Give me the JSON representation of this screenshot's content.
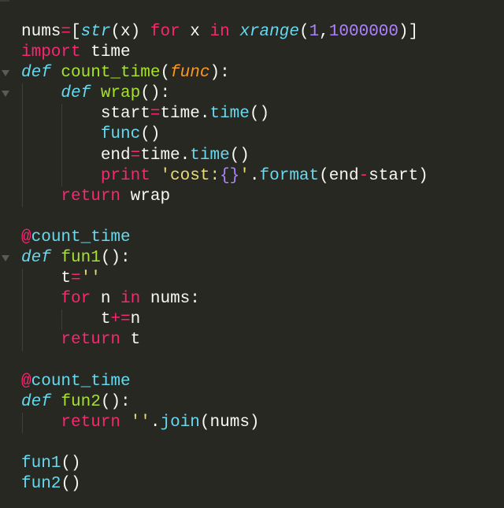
{
  "editor": {
    "theme_colors": {
      "background": "#272822",
      "keyword": "#f92672",
      "storage": "#66d9ef",
      "function_name": "#a6e22e",
      "parameter": "#fd971f",
      "number": "#ae81ff",
      "string": "#e6db74",
      "text": "#f8f8f2"
    },
    "lines": [
      {
        "fold": false,
        "indent": 0,
        "tokens": [
          {
            "t": "nums",
            "c": "plain"
          },
          {
            "t": "=",
            "c": "op"
          },
          {
            "t": "[",
            "c": "plain"
          },
          {
            "t": "str",
            "c": "bi"
          },
          {
            "t": "(x) ",
            "c": "plain"
          },
          {
            "t": "for",
            "c": "kw"
          },
          {
            "t": " x ",
            "c": "plain"
          },
          {
            "t": "in",
            "c": "kw"
          },
          {
            "t": " ",
            "c": "plain"
          },
          {
            "t": "xrange",
            "c": "bi"
          },
          {
            "t": "(",
            "c": "plain"
          },
          {
            "t": "1",
            "c": "num"
          },
          {
            "t": ",",
            "c": "plain"
          },
          {
            "t": "1000000",
            "c": "num"
          },
          {
            "t": ")]",
            "c": "plain"
          }
        ]
      },
      {
        "fold": false,
        "indent": 0,
        "tokens": [
          {
            "t": "import",
            "c": "kw"
          },
          {
            "t": " time",
            "c": "plain"
          }
        ]
      },
      {
        "fold": true,
        "indent": 0,
        "tokens": [
          {
            "t": "def",
            "c": "def"
          },
          {
            "t": " ",
            "c": "plain"
          },
          {
            "t": "count_time",
            "c": "fn"
          },
          {
            "t": "(",
            "c": "plain"
          },
          {
            "t": "func",
            "c": "arg"
          },
          {
            "t": "):",
            "c": "plain"
          }
        ]
      },
      {
        "fold": true,
        "indent": 1,
        "tokens": [
          {
            "t": "def",
            "c": "def"
          },
          {
            "t": " ",
            "c": "plain"
          },
          {
            "t": "wrap",
            "c": "fn"
          },
          {
            "t": "():",
            "c": "plain"
          }
        ]
      },
      {
        "fold": false,
        "indent": 2,
        "tokens": [
          {
            "t": "start",
            "c": "plain"
          },
          {
            "t": "=",
            "c": "op"
          },
          {
            "t": "time.",
            "c": "plain"
          },
          {
            "t": "time",
            "c": "call"
          },
          {
            "t": "()",
            "c": "plain"
          }
        ]
      },
      {
        "fold": false,
        "indent": 2,
        "tokens": [
          {
            "t": "func",
            "c": "call"
          },
          {
            "t": "()",
            "c": "plain"
          }
        ]
      },
      {
        "fold": false,
        "indent": 2,
        "tokens": [
          {
            "t": "end",
            "c": "plain"
          },
          {
            "t": "=",
            "c": "op"
          },
          {
            "t": "time.",
            "c": "plain"
          },
          {
            "t": "time",
            "c": "call"
          },
          {
            "t": "()",
            "c": "plain"
          }
        ]
      },
      {
        "fold": false,
        "indent": 2,
        "tokens": [
          {
            "t": "print",
            "c": "kw"
          },
          {
            "t": " ",
            "c": "plain"
          },
          {
            "t": "'cost:",
            "c": "str"
          },
          {
            "t": "{}",
            "c": "num"
          },
          {
            "t": "'",
            "c": "str"
          },
          {
            "t": ".",
            "c": "plain"
          },
          {
            "t": "format",
            "c": "call"
          },
          {
            "t": "(end",
            "c": "plain"
          },
          {
            "t": "-",
            "c": "op"
          },
          {
            "t": "start)",
            "c": "plain"
          }
        ]
      },
      {
        "fold": false,
        "indent": 1,
        "tokens": [
          {
            "t": "return",
            "c": "kw"
          },
          {
            "t": " wrap",
            "c": "plain"
          }
        ]
      },
      {
        "fold": false,
        "indent": 0,
        "tokens": []
      },
      {
        "fold": false,
        "indent": 0,
        "tokens": [
          {
            "t": "@",
            "c": "op"
          },
          {
            "t": "count_time",
            "c": "call"
          }
        ]
      },
      {
        "fold": true,
        "indent": 0,
        "tokens": [
          {
            "t": "def",
            "c": "def"
          },
          {
            "t": " ",
            "c": "plain"
          },
          {
            "t": "fun1",
            "c": "fn"
          },
          {
            "t": "():",
            "c": "plain"
          }
        ]
      },
      {
        "fold": false,
        "indent": 1,
        "tokens": [
          {
            "t": "t",
            "c": "plain"
          },
          {
            "t": "=",
            "c": "op"
          },
          {
            "t": "''",
            "c": "str"
          }
        ]
      },
      {
        "fold": false,
        "indent": 1,
        "tokens": [
          {
            "t": "for",
            "c": "kw"
          },
          {
            "t": " n ",
            "c": "plain"
          },
          {
            "t": "in",
            "c": "kw"
          },
          {
            "t": " nums:",
            "c": "plain"
          }
        ]
      },
      {
        "fold": false,
        "indent": 2,
        "tokens": [
          {
            "t": "t",
            "c": "plain"
          },
          {
            "t": "+=",
            "c": "op"
          },
          {
            "t": "n",
            "c": "plain"
          }
        ]
      },
      {
        "fold": false,
        "indent": 1,
        "tokens": [
          {
            "t": "return",
            "c": "kw"
          },
          {
            "t": " t",
            "c": "plain"
          }
        ]
      },
      {
        "fold": false,
        "indent": 0,
        "tokens": []
      },
      {
        "fold": false,
        "indent": 0,
        "tokens": [
          {
            "t": "@",
            "c": "op"
          },
          {
            "t": "count_time",
            "c": "call"
          }
        ]
      },
      {
        "fold": false,
        "indent": 0,
        "tokens": [
          {
            "t": "def",
            "c": "def"
          },
          {
            "t": " ",
            "c": "plain"
          },
          {
            "t": "fun2",
            "c": "fn"
          },
          {
            "t": "():",
            "c": "plain"
          }
        ]
      },
      {
        "fold": false,
        "indent": 1,
        "tokens": [
          {
            "t": "return",
            "c": "kw"
          },
          {
            "t": " ",
            "c": "plain"
          },
          {
            "t": "''",
            "c": "str"
          },
          {
            "t": ".",
            "c": "plain"
          },
          {
            "t": "join",
            "c": "call"
          },
          {
            "t": "(nums)",
            "c": "plain"
          }
        ]
      },
      {
        "fold": false,
        "indent": 0,
        "tokens": []
      },
      {
        "fold": false,
        "indent": 0,
        "tokens": [
          {
            "t": "fun1",
            "c": "call"
          },
          {
            "t": "()",
            "c": "plain"
          }
        ]
      },
      {
        "fold": false,
        "indent": 0,
        "tokens": [
          {
            "t": "fun2",
            "c": "call"
          },
          {
            "t": "()",
            "c": "plain"
          }
        ]
      }
    ]
  }
}
